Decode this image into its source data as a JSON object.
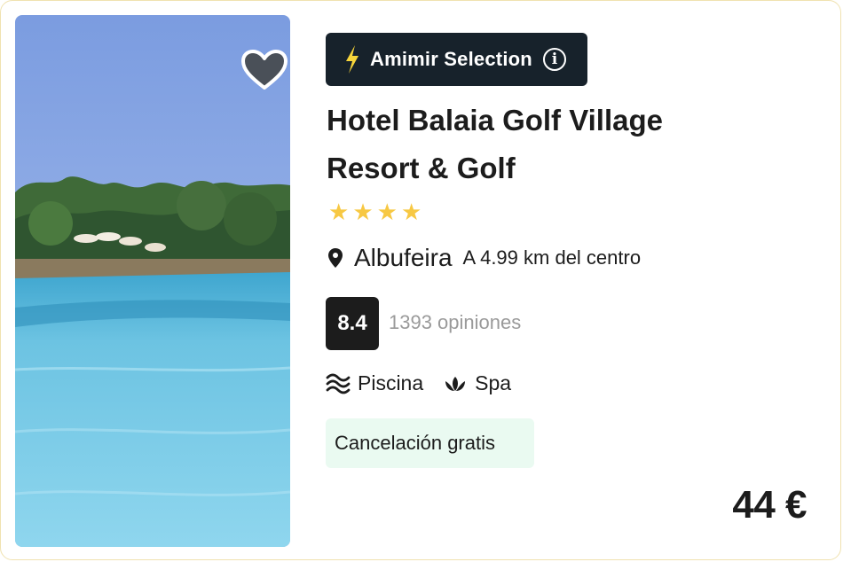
{
  "hotel": {
    "badge_label": "Amimir Selection",
    "name": "Hotel Balaia Golf Village Resort & Golf",
    "stars": 4,
    "city": "Albufeira",
    "distance": "A 4.99 km del centro",
    "rating": "8.4",
    "reviews": "1393 opiniones",
    "amenities": [
      {
        "label": "Piscina",
        "icon": "waves-icon"
      },
      {
        "label": "Spa",
        "icon": "lotus-icon"
      }
    ],
    "cancellation": "Cancelación gratis",
    "price": "44 €"
  },
  "icons": {
    "favorite": "heart-icon",
    "badge": "lightning-icon",
    "info": "info-icon",
    "location": "map-pin-icon"
  },
  "colors": {
    "badge_bg": "#17222b",
    "star": "#f7c843",
    "score_bg": "#1c1c1c",
    "cancel_bg": "#eafaf1",
    "bolt": "#f7d53a"
  }
}
